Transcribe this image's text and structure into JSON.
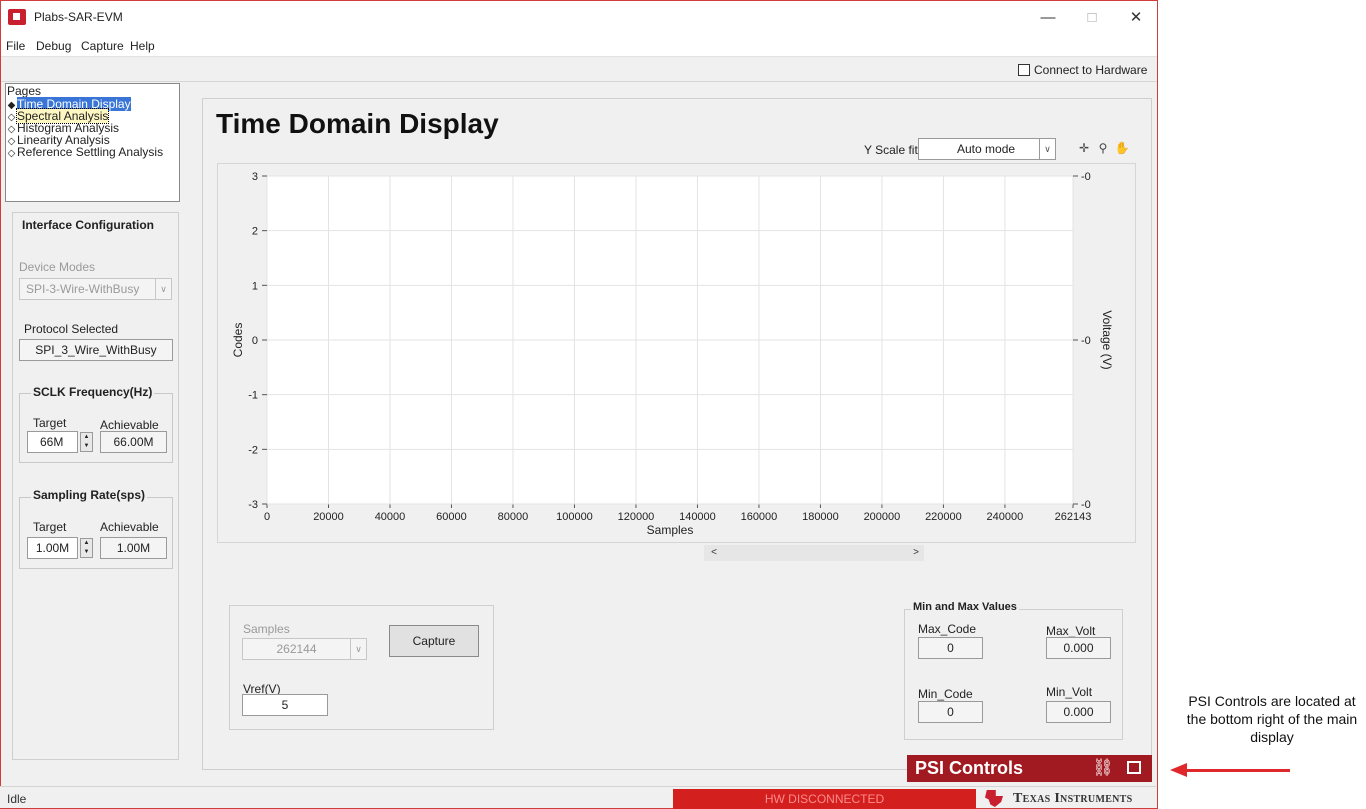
{
  "window": {
    "title": "Plabs-SAR-EVM",
    "min_glyph": "—",
    "max_glyph": "□",
    "close_glyph": "✕"
  },
  "menu": [
    "File",
    "Debug",
    "Capture",
    "Help"
  ],
  "toolbar": {
    "connect_label": "Connect to Hardware",
    "connect_checked": false
  },
  "pages": {
    "title": "Pages",
    "items": [
      {
        "label": "Time Domain Display",
        "selected": true
      },
      {
        "label": "Spectral Analysis",
        "focused": true
      },
      {
        "label": "Histogram Analysis"
      },
      {
        "label": "Linearity Analysis"
      },
      {
        "label": "Reference Settling Analysis"
      }
    ],
    "selected_glyph": "◆",
    "unselected_glyph": "◇"
  },
  "interface": {
    "title": "Interface Configuration",
    "device_modes_label": "Device Modes",
    "device_mode_value": "SPI-3-Wire-WithBusy",
    "protocol_label": "Protocol Selected",
    "protocol_value": "SPI_3_Wire_WithBusy",
    "sclk": {
      "title": "SCLK Frequency(Hz)",
      "target_label": "Target",
      "target_value": "66M",
      "achievable_label": "Achievable",
      "achievable_value": "66.00M"
    },
    "sampling": {
      "title": "Sampling Rate(sps)",
      "target_label": "Target",
      "target_value": "1.00M",
      "achievable_label": "Achievable",
      "achievable_value": "1.00M"
    }
  },
  "main": {
    "title": "Time Domain Display",
    "yscale_label": "Y Scale fit",
    "yscale_value": "Auto mode",
    "graph_tools": [
      "cursor-tool",
      "zoom-tool",
      "pan-tool"
    ],
    "samples_label": "Samples",
    "samples_value": "262144",
    "capture_label": "Capture",
    "vref_label": "Vref(V)",
    "vref_value": "5",
    "minmax": {
      "title": "Min and Max Values",
      "max_code_label": "Max_Code",
      "max_code_value": "0",
      "max_volt_label": "Max_Volt",
      "max_volt_value": "0.000",
      "min_code_label": "Min_Code",
      "min_code_value": "0",
      "min_volt_label": "Min_Volt",
      "min_volt_value": "0.000"
    },
    "scroll_left": "<",
    "scroll_right": ">"
  },
  "chart_data": {
    "type": "line",
    "xlabel": "Samples",
    "ylabel": "Codes",
    "y2label": "Voltage (V)",
    "xlim": [
      0,
      262143
    ],
    "ylim": [
      -3,
      3
    ],
    "x_ticks": [
      "0",
      "20000",
      "40000",
      "60000",
      "80000",
      "100000",
      "120000",
      "140000",
      "160000",
      "180000",
      "200000",
      "220000",
      "240000",
      "262143"
    ],
    "y_ticks": [
      "3",
      "2",
      "1",
      "0",
      "-1",
      "-2",
      "-3"
    ],
    "y2_ticks": [
      "-0",
      "-0",
      "-0"
    ],
    "grid": true,
    "series": []
  },
  "psi": {
    "label": "PSI Controls",
    "link_glyph": "⛓"
  },
  "status": {
    "idle": "Idle",
    "hw": "HW DISCONNECTED",
    "brand": "Texas Instruments"
  },
  "annotation": {
    "text": "PSI Controls are located at the bottom right of the main display"
  },
  "colors": {
    "brand_red": "#c8202f",
    "psi_bg": "#a21a21",
    "hw_disc_bg": "#d41f1f",
    "selection": "#3875d7",
    "annotation_arrow": "#e0272b"
  }
}
